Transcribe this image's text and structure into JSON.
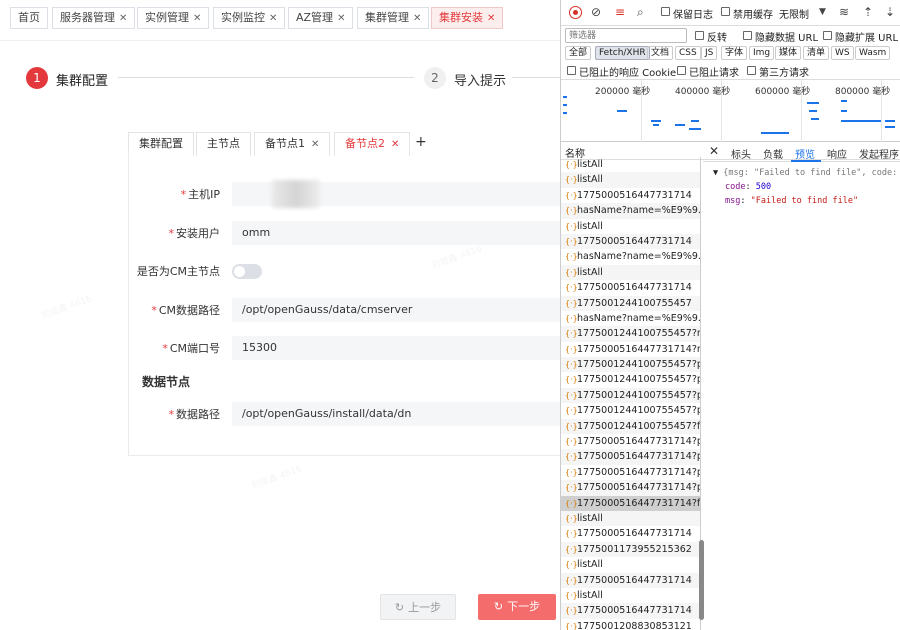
{
  "app": {
    "tabs": [
      {
        "label": "首页",
        "closable": false
      },
      {
        "label": "服务器管理",
        "closable": true
      },
      {
        "label": "实例管理",
        "closable": true
      },
      {
        "label": "实例监控",
        "closable": true
      },
      {
        "label": "AZ管理",
        "closable": true
      },
      {
        "label": "集群管理",
        "closable": true
      },
      {
        "label": "集群安装",
        "closable": true,
        "active": true
      }
    ],
    "close_glyph": "✕",
    "steps": [
      {
        "num": "1",
        "label": "集群配置",
        "active": true
      },
      {
        "num": "2",
        "label": "导入提示",
        "active": false
      }
    ],
    "subtabs": [
      {
        "label": "集群配置",
        "closable": false
      },
      {
        "label": "主节点",
        "closable": false
      },
      {
        "label": "备节点1",
        "closable": true
      },
      {
        "label": "备节点2",
        "closable": true,
        "active": true
      }
    ],
    "add_tab": "+",
    "form": {
      "host_ip": {
        "label": "主机IP",
        "value": ""
      },
      "install_user": {
        "label": "安装用户",
        "value": "omm"
      },
      "is_cm_master": {
        "label": "是否为CM主节点",
        "on": false
      },
      "cm_data_path": {
        "label": "CM数据路径",
        "value": "/opt/openGauss/data/cmserver"
      },
      "cm_port": {
        "label": "CM端口号",
        "value": "15300"
      },
      "data_node_section": "数据节点",
      "data_path": {
        "label": "数据路径",
        "value": "/opt/openGauss/install/data/dn"
      }
    },
    "required_mark": "*",
    "buttons": {
      "prev": "上一步",
      "next": "下一步"
    },
    "watermark": "刘增鑫 4616",
    "accent": "#e4393c"
  },
  "devtools": {
    "toolbar": {
      "preserve_log": "保留日志",
      "disable_cache": "禁用缓存",
      "throttle": "无限制"
    },
    "filter_placeholder": "筛选器",
    "invert": "反转",
    "hide_data_url": "隐藏数据 URL",
    "hide_ext_url": "隐藏扩展 URL",
    "types": [
      "全部",
      "Fetch/XHR",
      "文档",
      "CSS",
      "JS",
      "字体",
      "Img",
      "媒体",
      "清单",
      "WS",
      "Wasm"
    ],
    "selected_type": "Fetch/XHR",
    "options": [
      "已阻止的响应 Cookie",
      "已阻止请求",
      "第三方请求"
    ],
    "overview_labels": [
      "200000 毫秒",
      "400000 毫秒",
      "600000 毫秒",
      "800000 毫秒"
    ],
    "name_header": "名称",
    "requests": [
      "listAll",
      "listAll",
      "1775000516447731714",
      "hasName?name=%E9%9...",
      "listAll",
      "1775000516447731714",
      "hasName?name=%E9%9...",
      "listAll",
      "1775000516447731714",
      "1775001244100755457",
      "hasName?name=%E9%9...",
      "1775001244100755457?r...",
      "1775000516447731714?r...",
      "1775001244100755457?p...",
      "1775001244100755457?p...",
      "1775001244100755457?p...",
      "1775001244100755457?p...",
      "1775001244100755457?fi...",
      "1775000516447731714?p...",
      "1775000516447731714?p...",
      "1775000516447731714?p...",
      "1775000516447731714?p...",
      "1775000516447731714?fi...",
      "listAll",
      "1775000516447731714",
      "1775001173955215362",
      "listAll",
      "1775000516447731714",
      "listAll",
      "1775000516447731714",
      "1775001208830853121"
    ],
    "selected_request_index": 22,
    "detail_tabs": [
      "标头",
      "负载",
      "预览",
      "响应",
      "发起程序"
    ],
    "active_detail_tab": "预览",
    "preview": {
      "summary": "{msg: \"Failed to find file\", code: 500}",
      "code_key": "code",
      "code_value": "500",
      "msg_key": "msg",
      "msg_value": "\"Failed to find file\""
    }
  }
}
